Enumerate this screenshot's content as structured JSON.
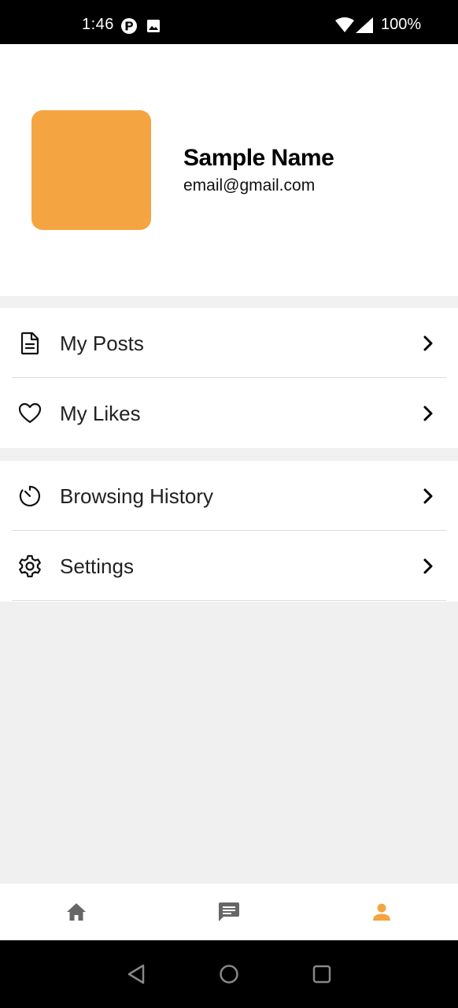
{
  "status_bar": {
    "time": "1:46",
    "battery": "100%",
    "icons": [
      "p-notification-icon",
      "image-notification-icon",
      "wifi-icon",
      "signal-icon"
    ]
  },
  "profile": {
    "name": "Sample Name",
    "email": "email@gmail.com",
    "avatar_color": "#f5a442"
  },
  "menu": {
    "groups": [
      {
        "items": [
          {
            "label": "My Posts",
            "icon": "document-icon"
          },
          {
            "label": "My Likes",
            "icon": "heart-icon"
          }
        ]
      },
      {
        "items": [
          {
            "label": "Browsing History",
            "icon": "timer-icon"
          },
          {
            "label": "Settings",
            "icon": "gear-icon"
          }
        ]
      }
    ]
  },
  "bottom_nav": {
    "items": [
      {
        "name": "home",
        "icon": "home-icon",
        "active": false
      },
      {
        "name": "messages",
        "icon": "message-icon",
        "active": false
      },
      {
        "name": "profile",
        "icon": "person-icon",
        "active": true
      }
    ],
    "active_color": "#f5a442",
    "inactive_color": "#666666"
  },
  "system_nav": {
    "buttons": [
      "back-icon",
      "home-circle-icon",
      "recents-icon"
    ]
  }
}
